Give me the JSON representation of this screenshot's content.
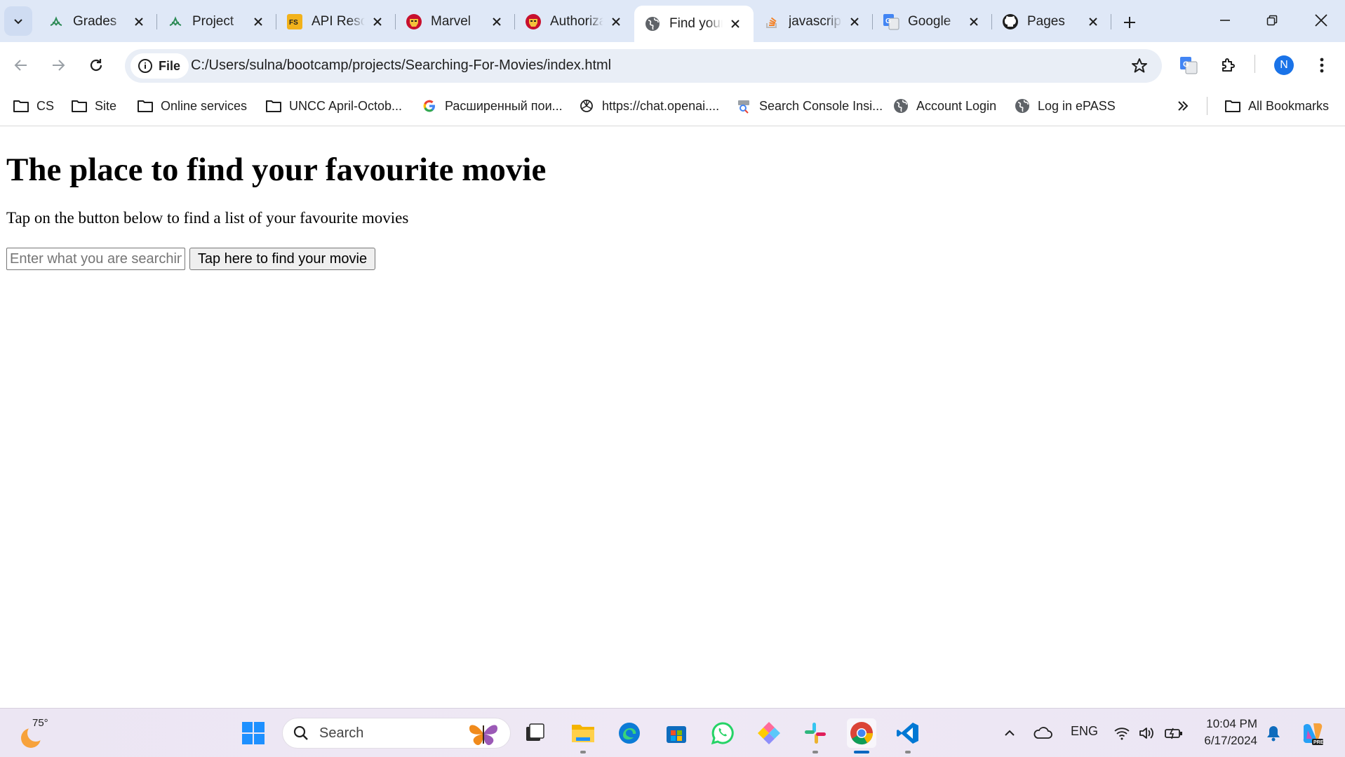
{
  "browser": {
    "tabs": [
      {
        "title": "Grades",
        "icon": "leaf-icon"
      },
      {
        "title": "Project",
        "icon": "leaf-icon"
      },
      {
        "title": "API Resources",
        "icon": "fs-icon"
      },
      {
        "title": "Marvel",
        "icon": "ironman-icon"
      },
      {
        "title": "Authorization",
        "icon": "ironman-icon"
      },
      {
        "title": "Find your",
        "icon": "globe-icon"
      },
      {
        "title": "javascript",
        "icon": "stackoverflow-icon"
      },
      {
        "title": "Google",
        "icon": "translate-icon"
      },
      {
        "title": "Pages",
        "icon": "github-icon"
      }
    ],
    "active_tab_index": 5,
    "address": {
      "scheme_label": "File",
      "url": "C:/Users/sulna/bootcamp/projects/Searching-For-Movies/index.html"
    },
    "profile_initial": "N",
    "bookmarks": [
      {
        "label": "CS",
        "icon": "folder-icon"
      },
      {
        "label": "Site",
        "icon": "folder-icon"
      },
      {
        "label": "Online services",
        "icon": "folder-icon"
      },
      {
        "label": "UNCC April-Octob...",
        "icon": "folder-icon"
      },
      {
        "label": "Расширенный пои...",
        "icon": "google-icon"
      },
      {
        "label": "https://chat.openai....",
        "icon": "openai-icon"
      },
      {
        "label": "Search Console Insi...",
        "icon": "search-console-icon"
      },
      {
        "label": "Account Login",
        "icon": "globe-icon"
      },
      {
        "label": "Log in ePASS",
        "icon": "globe-icon"
      }
    ],
    "all_bookmarks_label": "All Bookmarks"
  },
  "page": {
    "heading": "The place to find your favourite movie",
    "description": "Tap on the button below to find a list of your favourite movies",
    "search_placeholder": "Enter what you are searching",
    "button_label": "Tap here to find your movie"
  },
  "taskbar": {
    "temperature": "75°",
    "search_label": "Search",
    "language": "ENG",
    "time": "10:04 PM",
    "date": "6/17/2024",
    "accent": "#0067c0"
  }
}
